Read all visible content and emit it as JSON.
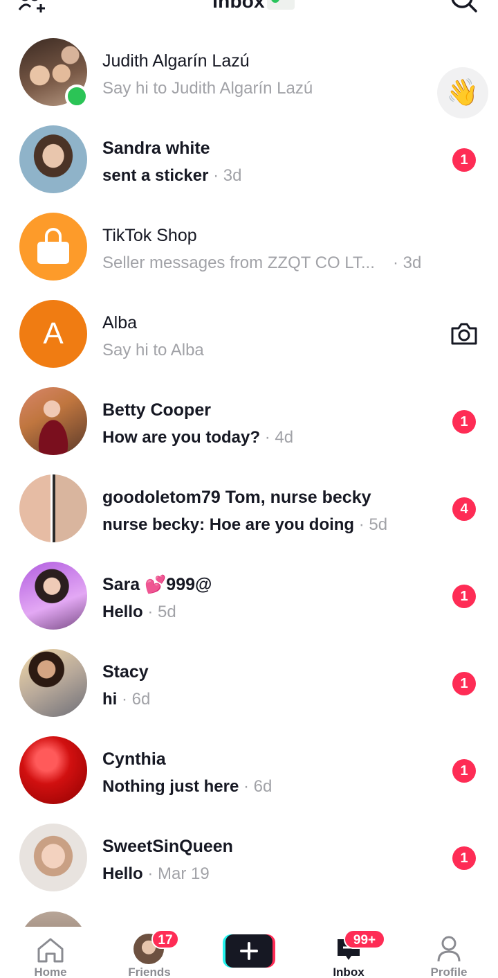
{
  "header": {
    "title": "Inbox",
    "add_friends_icon": "add-people-icon",
    "status_icon": "online-status-icon",
    "search_icon": "search-icon"
  },
  "conversations": [
    {
      "name": "Judith Algarín Lazú",
      "message": "Say hi to Judith Algarín Lazú",
      "time": "",
      "unread": false,
      "badge": "",
      "online": true,
      "action": "wave-icon"
    },
    {
      "name": "Sandra white",
      "message": "sent a sticker",
      "time": "· 3d",
      "unread": true,
      "badge": "1"
    },
    {
      "name": "TikTok Shop",
      "message": "Seller messages from ZZQT CO LT...",
      "time": "· 3d",
      "unread": false,
      "badge": "",
      "avatar_icon": "shopping-bag-icon"
    },
    {
      "name": "Alba",
      "message": "Say hi to Alba",
      "time": "",
      "unread": false,
      "badge": "",
      "avatar_letter": "A",
      "action": "camera-icon"
    },
    {
      "name": "Betty Cooper",
      "message": "How are you today?",
      "time": "· 4d",
      "unread": true,
      "badge": "1"
    },
    {
      "name": "goodoletom79 Tom, nurse becky",
      "message": "nurse becky: Hoe are you doing",
      "time": "· 5d",
      "unread": true,
      "badge": "4"
    },
    {
      "name": "Sara 💕999@",
      "message": "Hello",
      "time": "· 5d",
      "unread": true,
      "badge": "1"
    },
    {
      "name": "Stacy",
      "message": "hi",
      "time": "· 6d",
      "unread": true,
      "badge": "1"
    },
    {
      "name": "Cynthia",
      "message": "Nothing just here",
      "time": "· 6d",
      "unread": true,
      "badge": "1"
    },
    {
      "name": "SweetSinQueen",
      "message": "Hello",
      "time": "· Mar 19",
      "unread": true,
      "badge": "1"
    }
  ],
  "bottom_nav": {
    "home": {
      "label": "Home",
      "icon": "home-icon"
    },
    "friends": {
      "label": "Friends",
      "badge": "17",
      "icon": "friends-avatar-icon"
    },
    "create": {
      "icon": "plus-icon"
    },
    "inbox": {
      "label": "Inbox",
      "badge": "99+",
      "icon": "inbox-icon"
    },
    "profile": {
      "label": "Profile",
      "icon": "profile-icon"
    }
  },
  "colors": {
    "accent": "#fe2c55",
    "online": "#2bc456",
    "shop": "#fd9b2a",
    "letter_avatar": "#f07c12"
  }
}
